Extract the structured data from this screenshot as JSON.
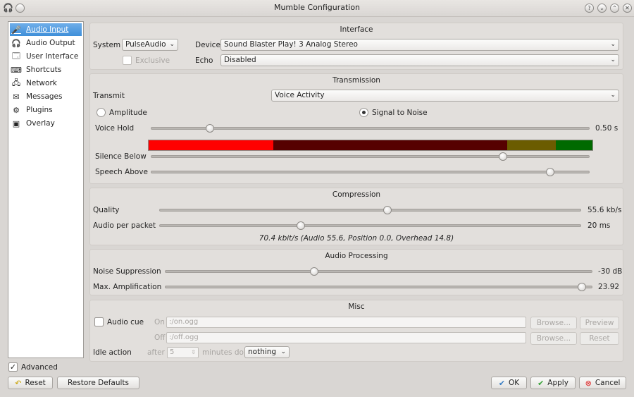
{
  "window": {
    "title": "Mumble Configuration"
  },
  "sidebar": {
    "items": [
      {
        "label": "Audio Input",
        "icon": "microphone-icon",
        "selected": true
      },
      {
        "label": "Audio Output",
        "icon": "headphones-icon"
      },
      {
        "label": "User Interface",
        "icon": "user-interface-icon"
      },
      {
        "label": "Shortcuts",
        "icon": "shortcuts-icon"
      },
      {
        "label": "Network",
        "icon": "network-icon"
      },
      {
        "label": "Messages",
        "icon": "messages-icon"
      },
      {
        "label": "Plugins",
        "icon": "plugins-icon"
      },
      {
        "label": "Overlay",
        "icon": "overlay-icon"
      }
    ]
  },
  "interface": {
    "title": "Interface",
    "system_label": "System",
    "system_value": "PulseAudio",
    "device_label": "Device",
    "device_value": "Sound Blaster Play! 3 Analog Stereo",
    "exclusive_label": "Exclusive",
    "echo_label": "Echo",
    "echo_value": "Disabled"
  },
  "transmission": {
    "title": "Transmission",
    "transmit_label": "Transmit",
    "transmit_value": "Voice Activity",
    "amplitude_label": "Amplitude",
    "snr_label": "Signal to Noise",
    "voice_hold_label": "Voice Hold",
    "voice_hold_value": "0.50 s",
    "silence_below_label": "Silence Below",
    "speech_above_label": "Speech Above",
    "meter_colors": [
      "#ff0000",
      "#560000",
      "#6b5c00",
      "#006a00"
    ]
  },
  "compression": {
    "title": "Compression",
    "quality_label": "Quality",
    "quality_value": "55.6 kb/s",
    "packet_label": "Audio per packet",
    "packet_value": "20 ms",
    "summary": "70.4 kbit/s (Audio 55.6, Position 0.0, Overhead 14.8)"
  },
  "processing": {
    "title": "Audio Processing",
    "noise_label": "Noise Suppression",
    "noise_value": "-30 dB",
    "amp_label": "Max. Amplification",
    "amp_value": "23.92"
  },
  "misc": {
    "title": "Misc",
    "audio_cue_label": "Audio cue",
    "on_label": "On",
    "on_value": ":/on.ogg",
    "off_label": "Off",
    "off_value": ":/off.ogg",
    "browse_label": "Browse...",
    "preview_label": "Preview",
    "reset_label": "Reset",
    "idle_label": "Idle action",
    "after_label": "after",
    "idle_minutes": "5",
    "minutes_do_label": "minutes do",
    "idle_action_value": "nothing"
  },
  "footer": {
    "advanced_label": "Advanced",
    "reset_label": "Reset",
    "restore_label": "Restore Defaults",
    "ok_label": "OK",
    "apply_label": "Apply",
    "cancel_label": "Cancel"
  }
}
